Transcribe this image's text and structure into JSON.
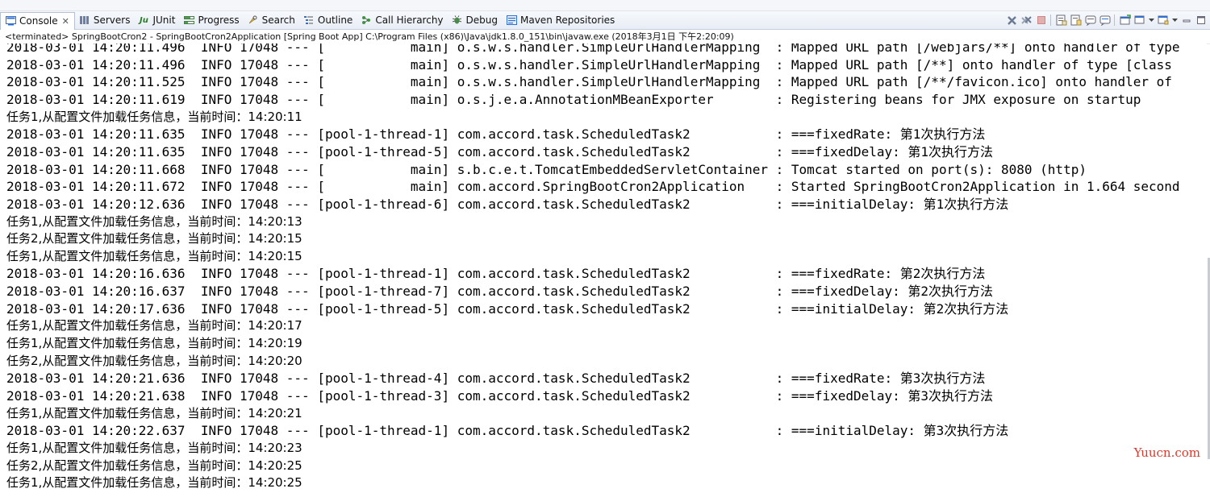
{
  "tabs": [
    {
      "label": "Console",
      "icon": "console-icon",
      "active": true
    },
    {
      "label": "Servers",
      "icon": "servers-icon"
    },
    {
      "label": "JUnit",
      "icon": "junit-icon"
    },
    {
      "label": "Progress",
      "icon": "progress-icon"
    },
    {
      "label": "Search",
      "icon": "search-icon"
    },
    {
      "label": "Outline",
      "icon": "outline-icon"
    },
    {
      "label": "Call Hierarchy",
      "icon": "call-hierarchy-icon"
    },
    {
      "label": "Debug",
      "icon": "debug-icon"
    },
    {
      "label": "Maven Repositories",
      "icon": "maven-repositories-icon"
    }
  ],
  "status_line": "<terminated> SpringBootCron2 - SpringBootCron2Application [Spring Boot App] C:\\Program Files (x86)\\Java\\jdk1.8.0_151\\bin\\javaw.exe (2018年3月1日 下午2:20:09)",
  "log_lines": [
    {
      "text": "2018-03-01 14:20:11.496  INFO 17048 --- [           main] o.s.w.s.handler.SimpleUrlHandlerMapping  : Mapped URL path [/webjars/**] onto handler of type",
      "cn": false
    },
    {
      "text": "2018-03-01 14:20:11.496  INFO 17048 --- [           main] o.s.w.s.handler.SimpleUrlHandlerMapping  : Mapped URL path [/**] onto handler of type [class",
      "cn": false
    },
    {
      "text": "2018-03-01 14:20:11.525  INFO 17048 --- [           main] o.s.w.s.handler.SimpleUrlHandlerMapping  : Mapped URL path [/**/favicon.ico] onto handler of",
      "cn": false
    },
    {
      "text": "2018-03-01 14:20:11.619  INFO 17048 --- [           main] o.s.j.e.a.AnnotationMBeanExporter        : Registering beans for JMX exposure on startup",
      "cn": false
    },
    {
      "text": "任务1,从配置文件加载任务信息，当前时间：14:20:11",
      "cn": true
    },
    {
      "text": "2018-03-01 14:20:11.635  INFO 17048 --- [pool-1-thread-1] com.accord.task.ScheduledTask2           : ===fixedRate: 第1次执行方法",
      "cn": false
    },
    {
      "text": "2018-03-01 14:20:11.635  INFO 17048 --- [pool-1-thread-5] com.accord.task.ScheduledTask2           : ===fixedDelay: 第1次执行方法",
      "cn": false
    },
    {
      "text": "2018-03-01 14:20:11.668  INFO 17048 --- [           main] s.b.c.e.t.TomcatEmbeddedServletContainer : Tomcat started on port(s): 8080 (http)",
      "cn": false
    },
    {
      "text": "2018-03-01 14:20:11.672  INFO 17048 --- [           main] com.accord.SpringBootCron2Application    : Started SpringBootCron2Application in 1.664 second",
      "cn": false
    },
    {
      "text": "2018-03-01 14:20:12.636  INFO 17048 --- [pool-1-thread-6] com.accord.task.ScheduledTask2           : ===initialDelay: 第1次执行方法",
      "cn": false
    },
    {
      "text": "任务1,从配置文件加载任务信息，当前时间：14:20:13",
      "cn": true
    },
    {
      "text": "任务2,从配置文件加载任务信息，当前时间：14:20:15",
      "cn": true
    },
    {
      "text": "任务1,从配置文件加载任务信息，当前时间：14:20:15",
      "cn": true
    },
    {
      "text": "2018-03-01 14:20:16.636  INFO 17048 --- [pool-1-thread-1] com.accord.task.ScheduledTask2           : ===fixedRate: 第2次执行方法",
      "cn": false
    },
    {
      "text": "2018-03-01 14:20:16.637  INFO 17048 --- [pool-1-thread-7] com.accord.task.ScheduledTask2           : ===fixedDelay: 第2次执行方法",
      "cn": false
    },
    {
      "text": "2018-03-01 14:20:17.636  INFO 17048 --- [pool-1-thread-5] com.accord.task.ScheduledTask2           : ===initialDelay: 第2次执行方法",
      "cn": false
    },
    {
      "text": "任务1,从配置文件加载任务信息，当前时间：14:20:17",
      "cn": true
    },
    {
      "text": "任务1,从配置文件加载任务信息，当前时间：14:20:19",
      "cn": true
    },
    {
      "text": "任务2,从配置文件加载任务信息，当前时间：14:20:20",
      "cn": true
    },
    {
      "text": "2018-03-01 14:20:21.636  INFO 17048 --- [pool-1-thread-4] com.accord.task.ScheduledTask2           : ===fixedRate: 第3次执行方法",
      "cn": false
    },
    {
      "text": "2018-03-01 14:20:21.638  INFO 17048 --- [pool-1-thread-3] com.accord.task.ScheduledTask2           : ===fixedDelay: 第3次执行方法",
      "cn": false
    },
    {
      "text": "任务1,从配置文件加载任务信息，当前时间：14:20:21",
      "cn": true
    },
    {
      "text": "2018-03-01 14:20:22.637  INFO 17048 --- [pool-1-thread-1] com.accord.task.ScheduledTask2           : ===initialDelay: 第3次执行方法",
      "cn": false
    },
    {
      "text": "任务1,从配置文件加载任务信息，当前时间：14:20:23",
      "cn": true
    },
    {
      "text": "任务2,从配置文件加载任务信息，当前时间：14:20:25",
      "cn": true
    },
    {
      "text": "任务1,从配置文件加载任务信息，当前时间：14:20:25",
      "cn": true
    }
  ],
  "watermark": "Yuucn.com",
  "colors": {
    "accent": "#2f6fcf",
    "watermark": "#d93b2f"
  }
}
